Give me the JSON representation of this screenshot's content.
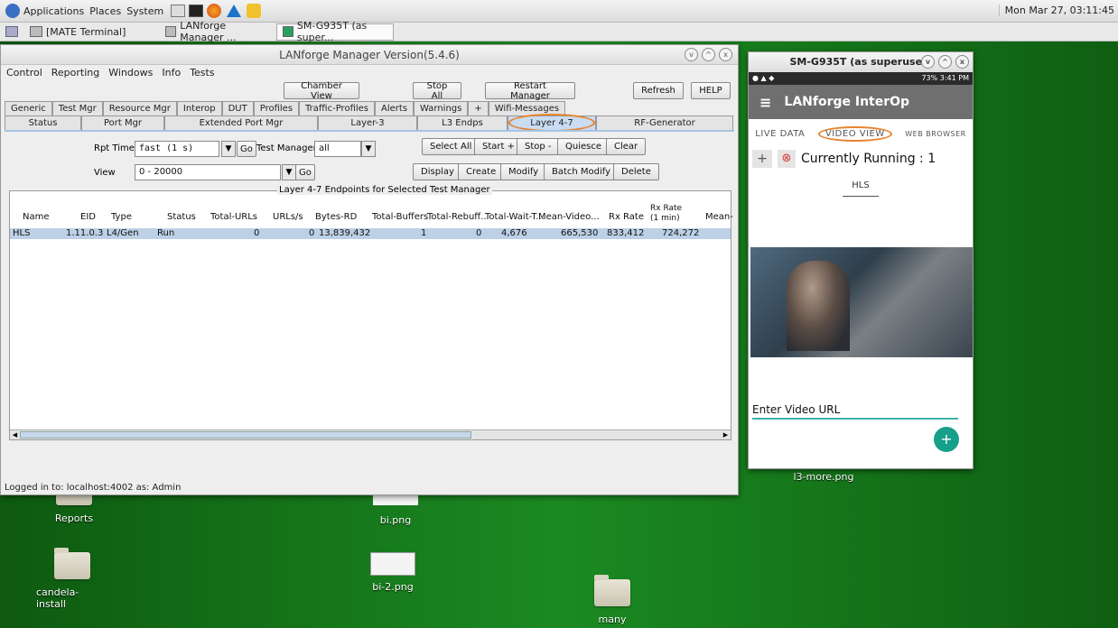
{
  "topbar": {
    "apps": "Applications",
    "places": "Places",
    "system": "System",
    "clock": "Mon Mar 27, 03:11:45"
  },
  "taskbar": {
    "items": [
      "[MATE Terminal]",
      "LANforge Manager ...",
      "SM-G935T (as super..."
    ]
  },
  "desktop": {
    "icons": [
      "Reports",
      "bi.png",
      "candela-install",
      "bi-2.png",
      "many",
      "l3-more.png"
    ]
  },
  "lf": {
    "title": "LANforge Manager   Version(5.4.6)",
    "menu": [
      "Control",
      "Reporting",
      "Windows",
      "Info",
      "Tests"
    ],
    "top_buttons": [
      "Chamber View",
      "Stop All",
      "Restart Manager",
      "Refresh",
      "HELP"
    ],
    "tabs_row1": [
      "Generic",
      "Test Mgr",
      "Resource Mgr",
      "Interop",
      "DUT",
      "Profiles",
      "Traffic-Profiles",
      "Alerts",
      "Warnings",
      "+",
      "Wifi-Messages"
    ],
    "tabs_row2": [
      "Status",
      "Port Mgr",
      "Extended Port Mgr",
      "Layer-3",
      "L3 Endps",
      "Layer 4-7",
      "RF-Generator"
    ],
    "rpt_timer_label": "Rpt Timer:",
    "rpt_timer_value": "fast      (1 s)",
    "go": "Go",
    "test_manager_label": "Test Manager",
    "test_manager_value": "all",
    "view_label": "View",
    "view_value": "0 - 20000",
    "action_row1": [
      "Select All",
      "Start +",
      "Stop -",
      "Quiesce",
      "Clear"
    ],
    "action_row2": [
      "Display",
      "Create",
      "Modify",
      "Batch Modify",
      "Delete"
    ],
    "table_title": "Layer 4-7 Endpoints for Selected Test Manager",
    "columns": [
      "Name",
      "EID",
      "Type",
      "Status",
      "Total-URLs",
      "URLs/s",
      "Bytes-RD",
      "Total-Buffers",
      "Total-Rebuff...",
      "Total-Wait-T...",
      "Mean-Video...",
      "Rx Rate",
      "Rx Rate (1 min)",
      "Mean-"
    ],
    "row": [
      "HLS",
      "1.11.0.3",
      "L4/Gen",
      "Run",
      "0",
      "0",
      "13,839,432",
      "1",
      "0",
      "4,676",
      "665,530",
      "833,412",
      "724,272",
      ""
    ],
    "status": "Logged in to:  localhost:4002  as:  Admin"
  },
  "android": {
    "title": "SM-G935T (as superuser)",
    "statusbar_right": "73% 3:41 PM",
    "app_title": "LANforge InterOp",
    "tabs": [
      "LIVE DATA",
      "VIDEO VIEW",
      "WEB BROWSER"
    ],
    "running": "Currently Running : 1",
    "hls": "HLS",
    "url_label": "Enter Video URL",
    "fab": "+"
  }
}
